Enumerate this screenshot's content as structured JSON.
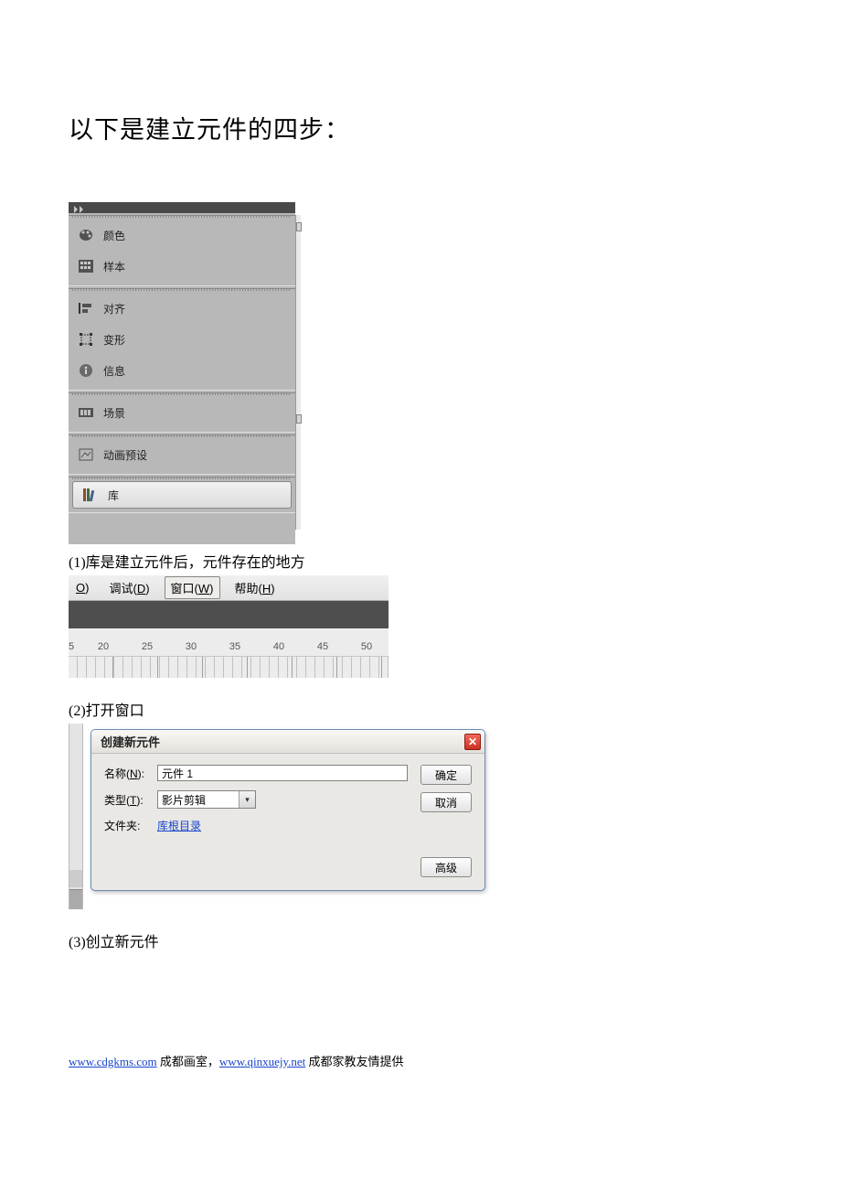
{
  "heading": "以下是建立元件的四步：",
  "panel": {
    "items": [
      {
        "label": "颜色",
        "icon": "palette"
      },
      {
        "label": "样本",
        "icon": "swatch"
      },
      {
        "label": "对齐",
        "icon": "align"
      },
      {
        "label": "变形",
        "icon": "transform"
      },
      {
        "label": "信息",
        "icon": "info"
      },
      {
        "label": "场景",
        "icon": "scene"
      },
      {
        "label": "动画预设",
        "icon": "anim"
      },
      {
        "label": "库",
        "icon": "library"
      }
    ]
  },
  "caption1": "(1)库是建立元件后，元件存在的地方",
  "menubar": {
    "o": "O",
    "o_paren": ")",
    "debug": "调试(",
    "debug_m": "D",
    "debug_close": ")",
    "window": "窗口(",
    "window_m": "W",
    "window_close": ")",
    "help": "帮助(",
    "help_m": "H",
    "help_close": ")"
  },
  "ruler": {
    "nums": [
      "5",
      "20",
      "25",
      "30",
      "35",
      "40",
      "45",
      "50"
    ]
  },
  "caption2": "(2)打开窗口",
  "dialog": {
    "title": "创建新元件",
    "name_label": "名称(",
    "name_m": "N",
    "name_close": "):",
    "name_value": "元件 1",
    "type_label": "类型(",
    "type_m": "T",
    "type_close": "):",
    "type_value": "影片剪辑",
    "folder_label": "文件夹:",
    "folder_link": "库根目录",
    "ok": "确定",
    "cancel": "取消",
    "advanced": "高级"
  },
  "caption3": "(3)创立新元件",
  "footer": {
    "link1": "www.cdgkms.com",
    "text1": " 成都画室，",
    "link2": "www.qinxuejy.net",
    "text2": " 成都家教友情提供"
  }
}
